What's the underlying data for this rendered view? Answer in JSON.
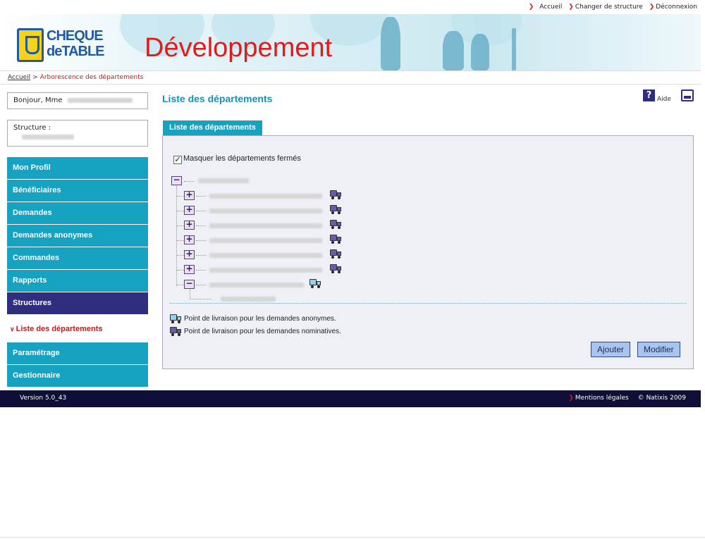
{
  "top_links": [
    {
      "label": "Accueil"
    },
    {
      "label": "Changer de structure"
    },
    {
      "label": "Déconnexion"
    }
  ],
  "banner": {
    "logo_line1": "CHEQUE",
    "logo_line2": "deTABLE",
    "title": "Développement"
  },
  "breadcrumb": {
    "home": "Accueil",
    "separator": ">",
    "current": "Arborescence des départements"
  },
  "sidebar": {
    "greeting": "Bonjour, Mme",
    "structure_label": "Structure :",
    "nav": [
      {
        "label": "Mon Profil",
        "active": false
      },
      {
        "label": "Bénéficiaires",
        "active": false
      },
      {
        "label": "Demandes",
        "active": false
      },
      {
        "label": "Demandes anonymes",
        "active": false
      },
      {
        "label": "Commandes",
        "active": false
      },
      {
        "label": "Rapports",
        "active": false
      },
      {
        "label": "Structures",
        "active": true
      }
    ],
    "sub_item": "Liste des départements",
    "nav_after": [
      {
        "label": "Paramétrage"
      },
      {
        "label": "Gestionnaire"
      }
    ]
  },
  "main": {
    "title": "Liste des départements",
    "help_label": "Aide",
    "tab_label": "Liste des départements",
    "hide_closed_label": "Masquer les départements fermés",
    "hide_closed_checked": true,
    "tree": {
      "root_expanded": true,
      "children_count": 6,
      "last_child_expanded": true
    },
    "legend": [
      {
        "icon": "truck-cyan-icon",
        "text": "Point de livraison pour les demandes anonymes."
      },
      {
        "icon": "truck-purple-icon",
        "text": "Point de livraison pour les demandes nominatives."
      }
    ],
    "buttons": {
      "add": "Ajouter",
      "edit": "Modifier"
    }
  },
  "footer": {
    "version": "Version 5.0_43",
    "legal": "Mentions légales",
    "copyright": "© Natixis 2009"
  },
  "colors": {
    "accent": "#16a2c1",
    "active_nav": "#2e2d80",
    "footer_bg": "#0f0e36",
    "title_red": "#e11b1b",
    "link_red": "#c41a1a"
  }
}
